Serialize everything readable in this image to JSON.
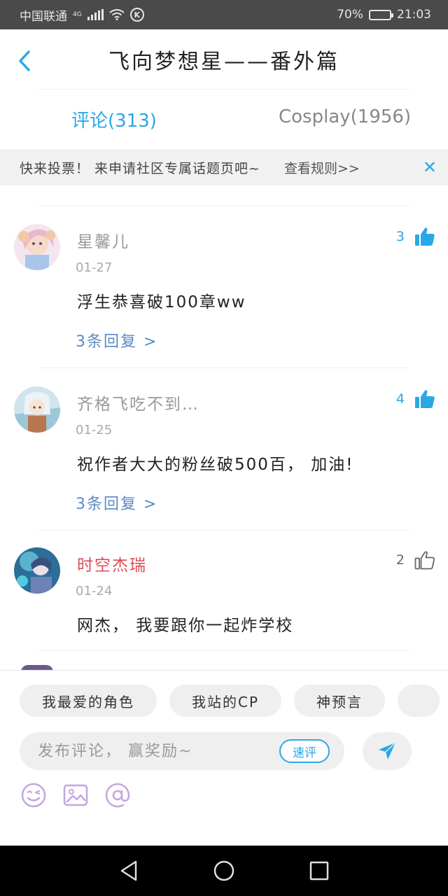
{
  "status": {
    "carrier": "中国联通",
    "network": "4G",
    "battery": "70%",
    "battery_level": 0.7,
    "time": "21:03"
  },
  "header": {
    "title": "飞向梦想星——番外篇"
  },
  "tabs": [
    {
      "label": "评论(313)",
      "active": true
    },
    {
      "label": "Cosplay(1956)",
      "active": false
    }
  ],
  "notice": {
    "text": "快来投票！ 来申请社区专属话题页吧~",
    "link": "查看规则>>",
    "close_icon": "close-icon"
  },
  "comments": [
    {
      "user": "星馨儿",
      "date": "01-27",
      "text": "浮生恭喜破100章ww",
      "replies": "3条回复 >",
      "likes": "3",
      "liked": true
    },
    {
      "user": "齐格飞吃不到…",
      "date": "01-25",
      "text": "祝作者大大的粉丝破500百， 加油!",
      "replies": "3条回复 >",
      "likes": "4",
      "liked": true
    },
    {
      "user": "时空杰瑞",
      "date": "01-24",
      "text": "网杰， 我要跟你一起炸学校",
      "likes": "2",
      "liked": false
    }
  ],
  "bottom": {
    "chips": [
      "我最爱的角色",
      "我站的CP",
      "神预言"
    ],
    "input_placeholder": "发布评论， 赢奖励~",
    "quick_comment": "速评"
  },
  "colors": {
    "accent": "#29a8e6",
    "vip_name": "#e04a55",
    "reply_link": "#5a8ac7"
  }
}
